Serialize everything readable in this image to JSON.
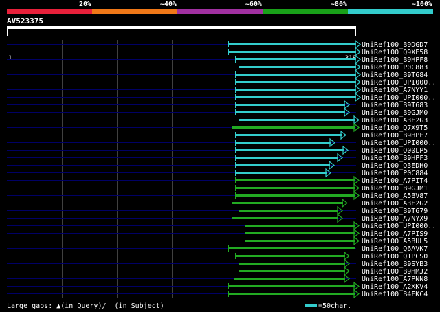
{
  "colors": {
    "background": "#000000",
    "trace": "#000066",
    "grid": "#404040",
    "cyan": "#33cccc",
    "green": "#22aa22",
    "query": "#ffffff"
  },
  "legend": [
    {
      "label": "20%",
      "color": "#e8203a"
    },
    {
      "label": "~40%",
      "color": "#f07818"
    },
    {
      "label": "~60%",
      "color": "#a030a0"
    },
    {
      "label": "~80%",
      "color": "#19a019"
    },
    {
      "label": "~100%",
      "color": "#33cccc"
    }
  ],
  "query": {
    "name": "AV523375",
    "start": "1",
    "end": "318",
    "length": 318
  },
  "hits": [
    {
      "label": "UniRef100_B9DGD7",
      "start": 202,
      "end": 318,
      "color": "cyan",
      "arrow": true
    },
    {
      "label": "UniRef100_Q9XE58",
      "start": 202,
      "end": 318,
      "color": "cyan",
      "arrow": true
    },
    {
      "label": "UniRef100_B9HPF8",
      "start": 208,
      "end": 318,
      "color": "cyan",
      "arrow": true
    },
    {
      "label": "UniRef100_P0C883",
      "start": 211,
      "end": 318,
      "color": "cyan",
      "arrow": true
    },
    {
      "label": "UniRef100_B9T684",
      "start": 208,
      "end": 318,
      "color": "cyan",
      "arrow": true
    },
    {
      "label": "UniRef100_UPI000..",
      "start": 208,
      "end": 318,
      "color": "cyan",
      "arrow": true
    },
    {
      "label": "UniRef100_A7NYY1",
      "start": 208,
      "end": 318,
      "color": "cyan",
      "arrow": true
    },
    {
      "label": "UniRef100_UPI000..",
      "start": 208,
      "end": 318,
      "color": "cyan",
      "arrow": true
    },
    {
      "label": "UniRef100_B9T683",
      "start": 208,
      "end": 308,
      "color": "cyan",
      "arrow": true
    },
    {
      "label": "UniRef100_B9GJM0",
      "start": 208,
      "end": 308,
      "color": "cyan",
      "arrow": true
    },
    {
      "label": "UniRef100_A3E2G3",
      "start": 211,
      "end": 317,
      "color": "cyan",
      "arrow": true
    },
    {
      "label": "UniRef100_Q7X9T5",
      "start": 205,
      "end": 317,
      "color": "green",
      "arrow": true
    },
    {
      "label": "UniRef100_B9HPF7",
      "start": 208,
      "end": 305,
      "color": "cyan",
      "arrow": true
    },
    {
      "label": "UniRef100_UPI000..",
      "start": 208,
      "end": 295,
      "color": "cyan",
      "arrow": true
    },
    {
      "label": "UniRef100_Q00LP5",
      "start": 208,
      "end": 307,
      "color": "cyan",
      "arrow": true
    },
    {
      "label": "UniRef100_B9HPF3",
      "start": 208,
      "end": 302,
      "color": "cyan",
      "arrow": true
    },
    {
      "label": "UniRef100_Q3EDH0",
      "start": 208,
      "end": 294,
      "color": "cyan",
      "arrow": true
    },
    {
      "label": "UniRef100_P0C884",
      "start": 208,
      "end": 291,
      "color": "cyan",
      "arrow": true
    },
    {
      "label": "UniRef100_A7PIT4",
      "start": 208,
      "end": 317,
      "color": "green",
      "arrow": true
    },
    {
      "label": "UniRef100_B9GJM1",
      "start": 208,
      "end": 317,
      "color": "green",
      "arrow": true
    },
    {
      "label": "UniRef100_A5BV87",
      "start": 208,
      "end": 317,
      "color": "green",
      "arrow": true
    },
    {
      "label": "UniRef100_A3E2G2",
      "start": 205,
      "end": 306,
      "color": "green",
      "arrow": true
    },
    {
      "label": "UniRef100_B9T679",
      "start": 211,
      "end": 302,
      "color": "green",
      "arrow": true
    },
    {
      "label": "UniRef100_A7NYX9",
      "start": 205,
      "end": 302,
      "color": "green",
      "arrow": true
    },
    {
      "label": "UniRef100_UPI000..",
      "start": 217,
      "end": 317,
      "color": "green",
      "arrow": true
    },
    {
      "label": "UniRef100_A7PIS9",
      "start": 217,
      "end": 317,
      "color": "green",
      "arrow": true
    },
    {
      "label": "UniRef100_A5BUL5",
      "start": 217,
      "end": 317,
      "color": "green",
      "arrow": true
    },
    {
      "label": "UniRef100_Q6AVK7",
      "start": 202,
      "end": 317,
      "color": "green",
      "arrow": false
    },
    {
      "label": "UniRef100_Q1PCS0",
      "start": 208,
      "end": 308,
      "color": "green",
      "arrow": true
    },
    {
      "label": "UniRef100_B9SYB3",
      "start": 211,
      "end": 308,
      "color": "green",
      "arrow": true
    },
    {
      "label": "UniRef100_B9HMJ2",
      "start": 211,
      "end": 308,
      "color": "green",
      "arrow": true
    },
    {
      "label": "UniRef100_A7PNN8",
      "start": 207,
      "end": 308,
      "color": "green",
      "arrow": true
    },
    {
      "label": "UniRef100_A2XKV4",
      "start": 202,
      "end": 317,
      "color": "green",
      "arrow": true
    },
    {
      "label": "UniRef100_B4FKC4",
      "start": 202,
      "end": 317,
      "color": "green",
      "arrow": true
    }
  ],
  "footer": {
    "text": "Large gaps: ▲(in Query)/⁻ (in Subject)",
    "scale_text": "=50char."
  }
}
